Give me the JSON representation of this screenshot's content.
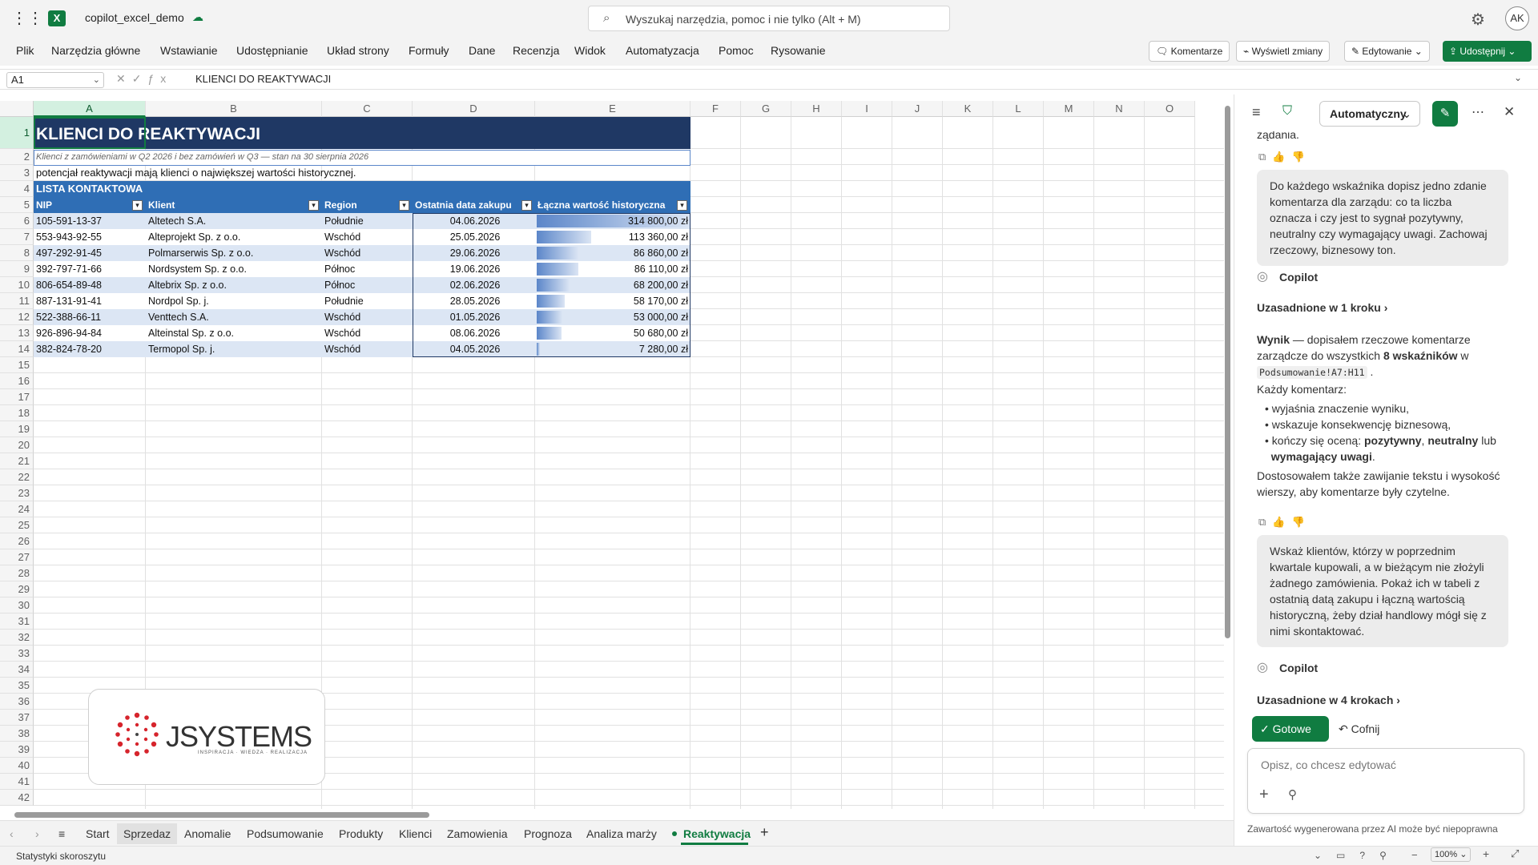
{
  "app": {
    "file_name": "copilot_excel_demo",
    "search_placeholder": "Wyszukaj narzędzia, pomoc i nie tylko (Alt + M)",
    "avatar": "AK"
  },
  "menu": [
    "Plik",
    "Narzędzia główne",
    "Wstawianie",
    "Udostępnianie",
    "Układ strony",
    "Formuły",
    "Dane",
    "Recenzja",
    "Widok",
    "Automatyzacja",
    "Pomoc",
    "Rysowanie"
  ],
  "ribbon_right": {
    "comments": "Komentarze",
    "changes": "Wyświetl zmiany",
    "editing": "Edytowanie",
    "share": "Udostępnij"
  },
  "formula_bar": {
    "name_box": "A1",
    "content": "KLIENCI DO REAKTYWACJI"
  },
  "columns": [
    "A",
    "B",
    "C",
    "D",
    "E",
    "F",
    "G",
    "H",
    "I",
    "J",
    "K",
    "L",
    "M",
    "N",
    "O"
  ],
  "rows": [
    "1",
    "2",
    "3",
    "4",
    "5",
    "6",
    "7",
    "8",
    "9",
    "10",
    "11",
    "12",
    "13",
    "14",
    "15",
    "16",
    "17",
    "18",
    "19",
    "20",
    "21",
    "22",
    "23",
    "24",
    "25",
    "26",
    "27",
    "28",
    "29",
    "30",
    "31",
    "32",
    "33",
    "34",
    "35",
    "36",
    "37",
    "38",
    "39",
    "40",
    "41",
    "42"
  ],
  "sheet": {
    "title": "KLIENCI DO REAKTYWACJI",
    "subtitle": "Klienci z zamówieniami w Q2 2026 i bez zamówień w Q3 — stan na 30 sierpnia 2026",
    "note": "potencjał reaktywacji mają klienci o największej wartości historycznej.",
    "section": "LISTA KONTAKTOWA",
    "headers": [
      "NIP",
      "Klient",
      "Region",
      "Ostatnia data zakupu",
      "Łączna wartość historyczna"
    ],
    "data_bar_max": 314800,
    "rows": [
      {
        "nip": "105-591-13-37",
        "client": "Altetech S.A.",
        "region": "Południe",
        "date": "04.06.2026",
        "value": "314 800,00 zł",
        "amount": 314800
      },
      {
        "nip": "553-943-92-55",
        "client": "Alteprojekt Sp. z o.o.",
        "region": "Wschód",
        "date": "25.05.2026",
        "value": "113 360,00 zł",
        "amount": 113360
      },
      {
        "nip": "497-292-91-45",
        "client": "Polmarserwis Sp. z o.o.",
        "region": "Wschód",
        "date": "29.06.2026",
        "value": "86 860,00 zł",
        "amount": 86860
      },
      {
        "nip": "392-797-71-66",
        "client": "Nordsystem Sp. z o.o.",
        "region": "Północ",
        "date": "19.06.2026",
        "value": "86 110,00 zł",
        "amount": 86110
      },
      {
        "nip": "806-654-89-48",
        "client": "Altebrix Sp. z o.o.",
        "region": "Północ",
        "date": "02.06.2026",
        "value": "68 200,00 zł",
        "amount": 68200
      },
      {
        "nip": "887-131-91-41",
        "client": "Nordpol Sp. j.",
        "region": "Południe",
        "date": "28.05.2026",
        "value": "58 170,00 zł",
        "amount": 58170
      },
      {
        "nip": "522-388-66-11",
        "client": "Venttech S.A.",
        "region": "Wschód",
        "date": "01.05.2026",
        "value": "53 000,00 zł",
        "amount": 53000
      },
      {
        "nip": "926-896-94-84",
        "client": "Alteinstal Sp. z o.o.",
        "region": "Wschód",
        "date": "08.06.2026",
        "value": "50 680,00 zł",
        "amount": 50680
      },
      {
        "nip": "382-824-78-20",
        "client": "Termopol Sp. j.",
        "region": "Wschód",
        "date": "04.05.2026",
        "value": "7 280,00 zł",
        "amount": 7280
      }
    ]
  },
  "logo": {
    "brand": "JSYSTEMS",
    "tagline": "INSPIRACJA · WIEDZA · REALIZACJA"
  },
  "tabs": [
    "Start",
    "Sprzedaz",
    "Anomalie",
    "Podsumowanie",
    "Produkty",
    "Klienci",
    "Zamowienia",
    "Prognoza",
    "Analiza marży",
    "Reaktywacja"
  ],
  "active_tab": "Reaktywacja",
  "status": {
    "left": "Statystyki skoroszytu",
    "zoom": "100%"
  },
  "copilot": {
    "mode": "Automatyczny",
    "cut_text": "żądania.",
    "msg1": "Do każdego wskaźnika dopisz jedno zdanie komentarza dla zarządu: co ta liczba oznacza i czy jest to sygnał pozytywny, neutralny czy wymagający uwagi. Zachowaj rzeczowy, biznesowy ton.",
    "copilot_label": "Copilot",
    "steps1": "Uzasadnione w 1 kroku",
    "result_bold": "Wynik",
    "result_text": " — dopisałem rzeczowe komentarze zarządcze do wszystkich ",
    "result_count": "8 wskaźników",
    "result_in": " w",
    "result_range": "Podsumowanie!A7:H11",
    "each": "Każdy komentarz:",
    "bullet1": "wyjaśnia znaczenie wyniku,",
    "bullet2": "wskazuje konsekwencję biznesową,",
    "bullet3a": "kończy się oceną: ",
    "bullet3b": "pozytywny",
    "bullet3c": ", ",
    "bullet3d": "neutralny",
    "bullet3e": " lub ",
    "bullet3f": "wymagający uwagi",
    "bullet3g": ".",
    "adjust": "Dostosowałem także zawijanie tekstu i wysokość wierszy, aby komentarze były czytelne.",
    "msg2": "Wskaż klientów, którzy w poprzednim kwartale kupowali, a w bieżącym nie złożyli żadnego zamówienia. Pokaż ich w tabeli z ostatnią datą zakupu i łączną wartością historyczną, żeby dział handlowy mógł się z nimi skontaktować.",
    "steps2": "Uzasadnione w 4 krokach",
    "done": "Gotowe",
    "undo": "Cofnij",
    "input_placeholder": "Opisz, co chcesz edytować",
    "disclaimer": "Zawartość wygenerowana przez AI może być niepoprawna"
  },
  "colors": {
    "excel_green": "#107c41",
    "title_fill": "#1f3864",
    "header_fill": "#2f6eb5",
    "band_fill": "#dce6f4",
    "data_bar": "#5b86c9"
  }
}
